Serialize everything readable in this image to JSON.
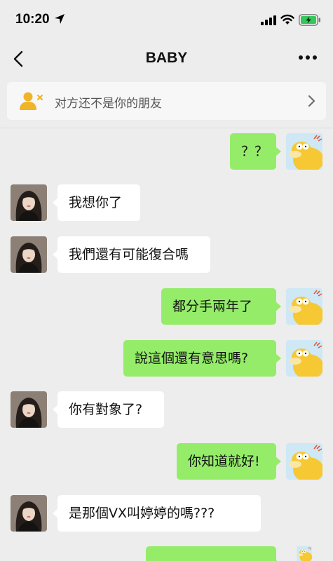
{
  "status_bar": {
    "time": "10:20"
  },
  "header": {
    "title": "BABY"
  },
  "notice": {
    "text": "对方还不是你的朋友"
  },
  "messages": [
    {
      "side": "out",
      "text": "？？"
    },
    {
      "side": "in",
      "text": "我想你了"
    },
    {
      "side": "in",
      "text": "我們還有可能復合嗎"
    },
    {
      "side": "out",
      "text": "都分手兩年了"
    },
    {
      "side": "out",
      "text": "說這個還有意思嗎?"
    },
    {
      "side": "in",
      "text": "你有對象了?"
    },
    {
      "side": "out",
      "text": "你知道就好!"
    },
    {
      "side": "in",
      "text": "是那個VX叫婷婷的嗎???"
    },
    {
      "side": "out",
      "text": ""
    }
  ],
  "colors": {
    "background": "#ededed",
    "bubble_out": "#95ec69",
    "bubble_in": "#ffffff",
    "notice_icon": "#f0b429"
  },
  "icons": {
    "location": "location-arrow-icon",
    "signal": "cellular-signal-icon",
    "wifi": "wifi-icon",
    "battery": "battery-charging-icon",
    "back": "chevron-left-icon",
    "more": "more-dots-icon",
    "notice": "user-not-friend-icon",
    "chevron": "chevron-right-icon"
  }
}
